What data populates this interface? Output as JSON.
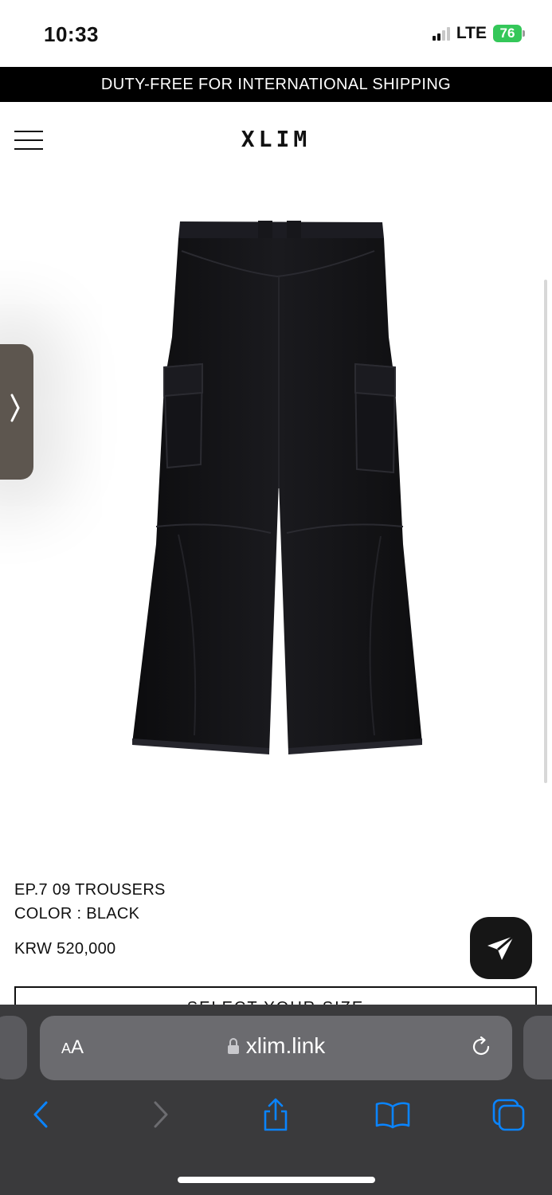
{
  "status_bar": {
    "time": "10:33",
    "network": "LTE",
    "battery": "76"
  },
  "promo_banner": {
    "text": "DUTY-FREE FOR INTERNATIONAL SHIPPING"
  },
  "header": {
    "brand": "XLIM",
    "menu_icon": "hamburger-menu-icon"
  },
  "product": {
    "image_subject": "black cargo trousers, back view",
    "name": "EP.7 09 TROUSERS",
    "color": "COLOR : BLACK",
    "price": "KRW 520,000",
    "size_select": "SELECT YOUR SIZE"
  },
  "side_tab": {
    "icon": "chevron-right-icon"
  },
  "browser": {
    "reader_label_big": "A",
    "reader_label_small": "A",
    "url": "xlim.link",
    "lock_icon": "lock-icon",
    "reload_icon": "reload-icon",
    "toolbar": [
      "back-icon",
      "forward-icon",
      "share-icon",
      "bookmarks-icon",
      "tabs-icon"
    ],
    "accent": "#0a84ff"
  },
  "colors": {
    "banner_bg": "#000000",
    "battery": "#34c759",
    "browser_bg": "#3a3a3c"
  }
}
